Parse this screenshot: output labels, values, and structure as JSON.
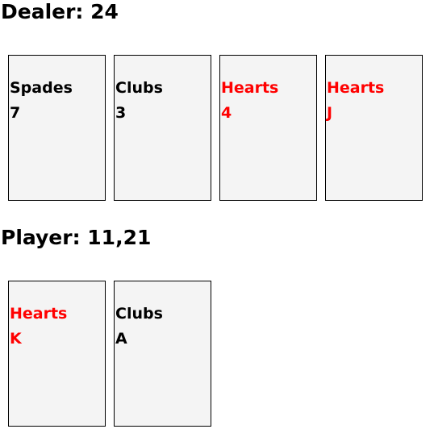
{
  "dealer": {
    "label": "Dealer: 24",
    "cards": [
      {
        "suit": "Spades",
        "rank": "7",
        "color": "#000000"
      },
      {
        "suit": "Clubs",
        "rank": "3",
        "color": "#000000"
      },
      {
        "suit": "Hearts",
        "rank": "4",
        "color": "#ff0000"
      },
      {
        "suit": "Hearts",
        "rank": "J",
        "color": "#ff0000"
      }
    ]
  },
  "player": {
    "label": "Player: 11,21",
    "cards": [
      {
        "suit": "Hearts",
        "rank": "K",
        "color": "#ff0000"
      },
      {
        "suit": "Clubs",
        "rank": "A",
        "color": "#000000"
      }
    ]
  },
  "theme": {
    "card_background": "#f4f4f4",
    "card_border": "#000000"
  }
}
